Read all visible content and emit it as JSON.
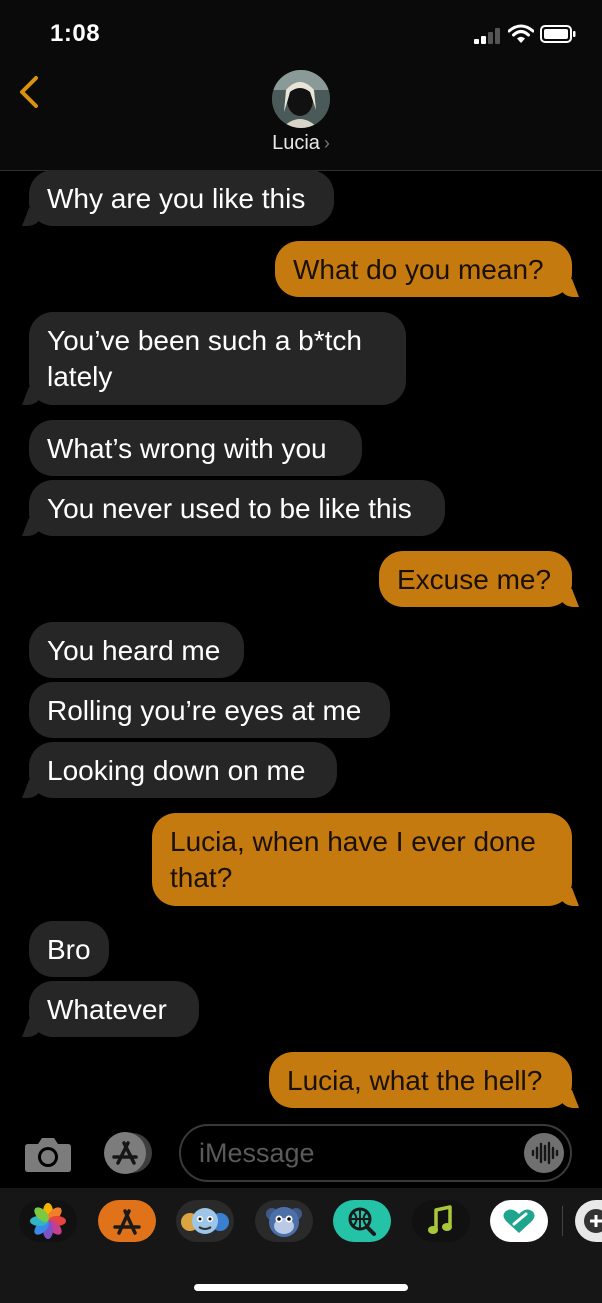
{
  "status_bar": {
    "time": "1:08"
  },
  "header": {
    "contact_name": "Lucia",
    "chevron": "›"
  },
  "messages": [
    {
      "from": "them",
      "text": "Why are you like this"
    },
    {
      "from": "me",
      "text": "What do you mean?"
    },
    {
      "from": "them",
      "text": "You’ve been such a b*tch lately"
    },
    {
      "from": "them",
      "text": "What’s wrong with you"
    },
    {
      "from": "them",
      "text": "You never used to be like this"
    },
    {
      "from": "me",
      "text": "Excuse me?"
    },
    {
      "from": "them",
      "text": "You heard me"
    },
    {
      "from": "them",
      "text": "Rolling you’re eyes at me"
    },
    {
      "from": "them",
      "text": "Looking down on me"
    },
    {
      "from": "me",
      "text": "Lucia, when have I ever done that?"
    },
    {
      "from": "them",
      "text": "Bro"
    },
    {
      "from": "them",
      "text": "Whatever"
    },
    {
      "from": "me",
      "text": "Lucia, what the hell?"
    }
  ],
  "compose": {
    "placeholder": "iMessage"
  },
  "app_drawer": {
    "icons": [
      "photos-icon",
      "app-store-icon",
      "memoji-stickers-icon",
      "animoji-icon",
      "web-search-icon",
      "music-icon",
      "digital-touch-icon",
      "more-apps-icon"
    ]
  },
  "colors": {
    "accent": "#c47a0f",
    "received_bubble": "#262626",
    "background": "#000000"
  }
}
